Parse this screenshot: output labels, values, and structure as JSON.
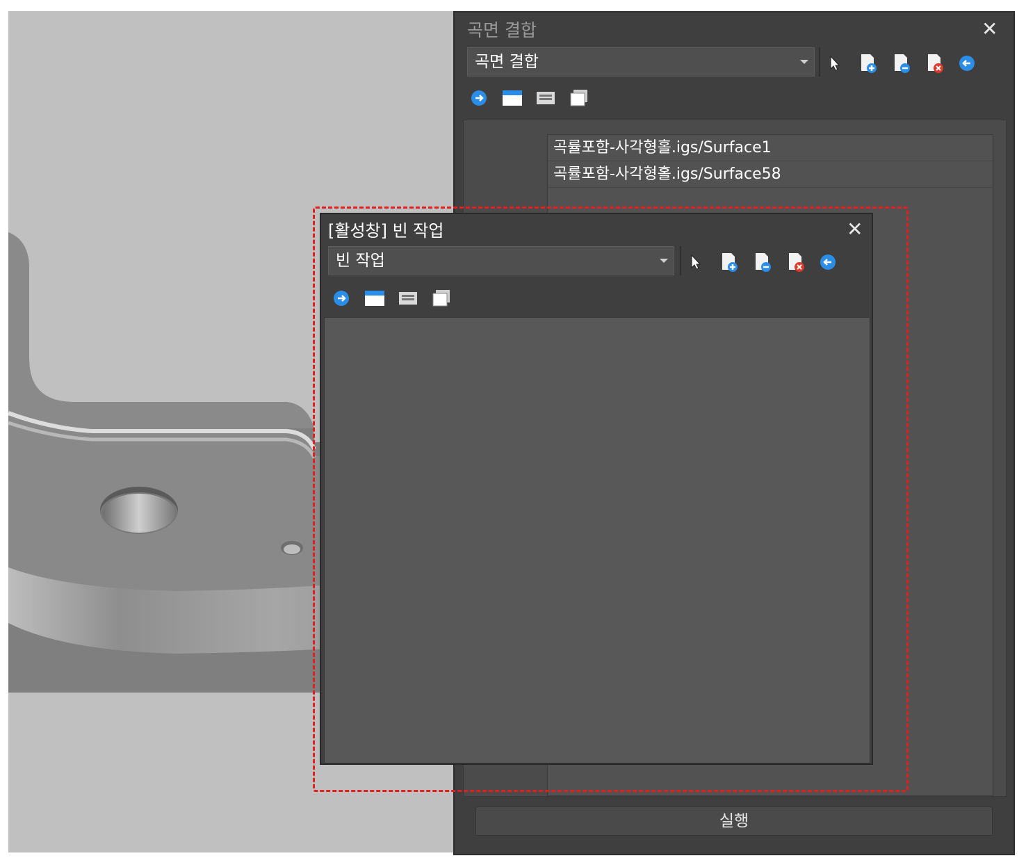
{
  "back_panel": {
    "title": "곡면 결합",
    "combo_value": "곡면 결합",
    "surfaces": [
      "곡률포함-사각형홀.igs/Surface1",
      "곡률포함-사각형홀.igs/Surface58"
    ],
    "run_label": "실행"
  },
  "front_panel": {
    "title": "[활성창] 빈 작업",
    "combo_value": "빈 작업"
  },
  "icons": {
    "close": "close-icon",
    "select": "cursor-icon",
    "add": "file-add-icon",
    "remove": "file-remove-icon",
    "delete": "file-delete-icon",
    "back": "arrow-left-icon",
    "forward": "arrow-right-icon",
    "window": "window-icon",
    "panel": "panel-icon",
    "layers": "layers-icon"
  },
  "colors": {
    "highlight": "#e0201e",
    "accent_blue": "#2a8ee8"
  }
}
